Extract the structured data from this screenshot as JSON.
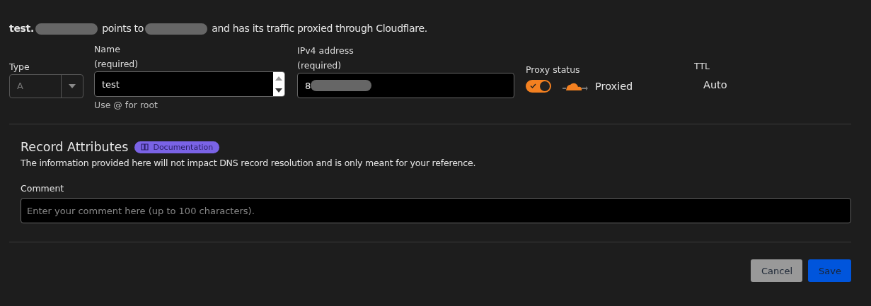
{
  "intro": [
    {
      "text": "**test.**",
      "redacted_after": true
    },
    {
      "text": "points to",
      "redacted_after": true
    },
    {
      "text": "and has its traffic proxied through Cloudflare.",
      "redacted_after": false
    }
  ],
  "type_field": {
    "label": "Type",
    "value": "A"
  },
  "name_field": {
    "label": "Name",
    "required": "(required)",
    "value": "test",
    "hint": "Use @ for root"
  },
  "ipv4_field": {
    "label": "IPv4 address",
    "required": "(required)",
    "value": "8",
    "redacted": true
  },
  "proxy": {
    "label": "Proxy status",
    "on": true,
    "status": "Proxied"
  },
  "ttl": {
    "label": "TTL",
    "value": "Auto"
  },
  "attributes": {
    "title": "Record Attributes",
    "badge": "Documentation",
    "description": "The information provided here will not impact DNS record resolution and is only meant for your reference.",
    "comment_label": "Comment",
    "comment_placeholder": "Enter your comment here (up to 100 characters)."
  },
  "buttons": [
    {
      "label": "Cancel",
      "kind": "secondary"
    },
    {
      "label": "Save",
      "kind": "primary"
    }
  ]
}
